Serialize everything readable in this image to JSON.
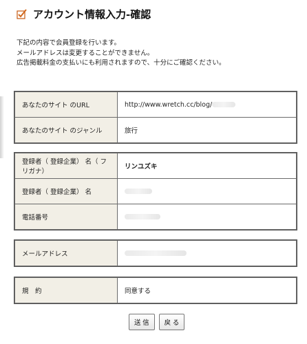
{
  "header": {
    "title": "アカウント情報入力-確認",
    "icon": "checkbox-check-icon",
    "accent": "#d2691e"
  },
  "intro": {
    "lines": [
      "下記の内容で会員登録を行います。",
      "メールアドレスは変更することができません。",
      "広告掲載料金の支払いにも利用されますので、十分にご確認ください。"
    ]
  },
  "site": {
    "rows": [
      {
        "label": "あなたのサイト のURL",
        "value": "http://www.wretch.cc/blog/"
      },
      {
        "label": "あなたのサイト のジャンル",
        "value": "旅行"
      }
    ]
  },
  "registrant": {
    "rows": [
      {
        "label": "登録者（ 登録企業） 名（ フリガナ）",
        "value": "リンユズキ"
      },
      {
        "label": "登録者（ 登録企業） 名",
        "value": ""
      },
      {
        "label": "電話番号",
        "value": ""
      }
    ]
  },
  "email": {
    "rows": [
      {
        "label": "メールアドレス",
        "value": ""
      }
    ]
  },
  "terms": {
    "rows": [
      {
        "label": "規　約",
        "value": "同意する"
      }
    ]
  },
  "buttons": {
    "submit_label": "送 信",
    "back_label": "戻 る"
  }
}
